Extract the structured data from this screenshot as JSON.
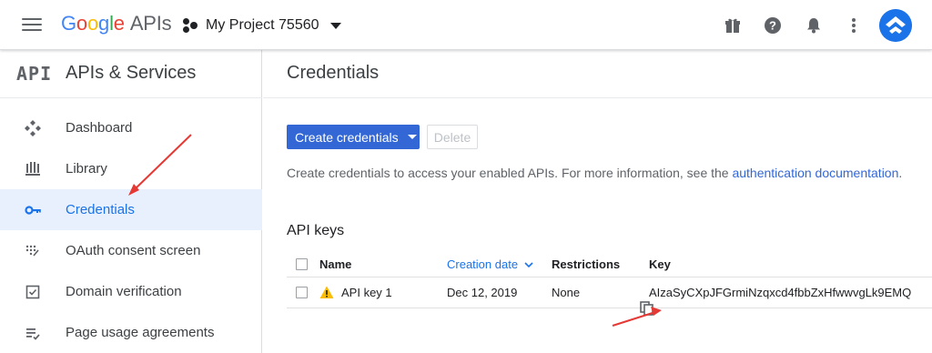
{
  "topbar": {
    "brand_parts": [
      "G",
      "o",
      "o",
      "g",
      "l",
      "e"
    ],
    "brand_suffix": "APIs",
    "project_name": "My Project 75560",
    "icons": [
      "gift-icon",
      "help-icon",
      "notifications-icon",
      "more-vert-icon"
    ]
  },
  "sidebar": {
    "logo": "API",
    "title": "APIs & Services",
    "items": [
      {
        "label": "Dashboard",
        "icon": "dashboard-icon"
      },
      {
        "label": "Library",
        "icon": "library-icon"
      },
      {
        "label": "Credentials",
        "icon": "key-icon",
        "active": true
      },
      {
        "label": "OAuth consent screen",
        "icon": "oauth-consent-icon"
      },
      {
        "label": "Domain verification",
        "icon": "domain-check-icon"
      },
      {
        "label": "Page usage agreements",
        "icon": "agreements-icon"
      }
    ]
  },
  "main": {
    "title": "Credentials",
    "create_button": "Create credentials",
    "delete_button": "Delete",
    "help_text": "Create credentials to access your enabled APIs. For more information, see the ",
    "help_link": "authentication documentation",
    "help_end": ".",
    "section_title": "API keys",
    "table": {
      "headers": {
        "name": "Name",
        "creation_date": "Creation date",
        "restrictions": "Restrictions",
        "key": "Key"
      },
      "rows": [
        {
          "name": "API key 1",
          "creation_date": "Dec 12, 2019",
          "restrictions": "None",
          "key": "AIzaSyCXpJFGrmiNzqxcd4fbbZxHfwwvgLk9EMQ"
        }
      ]
    }
  },
  "colors": {
    "accent": "#1a73e8",
    "primary_button": "#3367d6",
    "annotation_arrow": "#e53935",
    "warning": "#fbbc05"
  }
}
